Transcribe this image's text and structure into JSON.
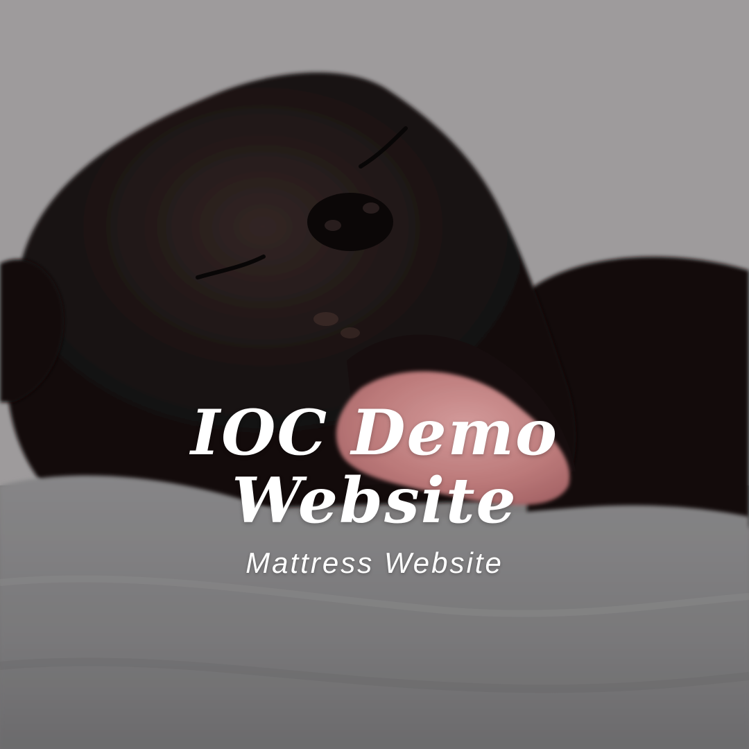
{
  "hero": {
    "title_line_1": "IOC Demo",
    "title_line_2": "Website",
    "subtitle": "Mattress Website"
  },
  "colors": {
    "text": "#ffffff",
    "background_wall": "#b3b0b1",
    "bedding": "#8e8c8d",
    "dog_fur": "#1f1717",
    "tongue": "#d98d8d"
  },
  "icons": {
    "hero_image": "sleeping-dog-photo"
  }
}
